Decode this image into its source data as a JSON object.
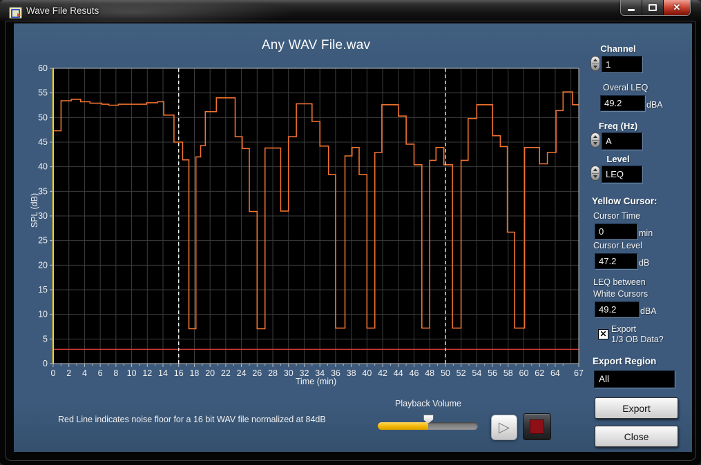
{
  "window": {
    "title": "Wave File Resuts"
  },
  "icons": {
    "close_glyph": "✕",
    "checkbox_mark": "✕",
    "play_glyph": "▷"
  },
  "chart_data": {
    "type": "line",
    "title": "Any WAV File.wav",
    "xlabel": "Time (min)",
    "ylabel": "SPL (dB)",
    "xlim": [
      0,
      67
    ],
    "ylim": [
      0,
      60
    ],
    "grid": true,
    "grid_step_x": 2,
    "grid_step_y": 5,
    "xticks": [
      0,
      2,
      4,
      6,
      8,
      10,
      12,
      14,
      16,
      18,
      20,
      22,
      24,
      26,
      28,
      30,
      32,
      34,
      36,
      38,
      40,
      42,
      44,
      46,
      48,
      50,
      52,
      54,
      56,
      58,
      60,
      62,
      64,
      67
    ],
    "yticks": [
      0,
      5,
      10,
      15,
      20,
      25,
      30,
      35,
      40,
      45,
      50,
      55,
      60
    ],
    "noise_floor_db": 2.9,
    "cursors": {
      "yellow": {
        "time_min": 0
      },
      "white": [
        {
          "time_min": 16
        },
        {
          "time_min": 50
        }
      ]
    },
    "series": [
      {
        "name": "SPL trace",
        "color": "#ef7230",
        "mode": "step",
        "end_time": 67,
        "steps": [
          [
            0,
            47.3
          ],
          [
            1,
            53.4
          ],
          [
            2.3,
            53.7
          ],
          [
            3.5,
            53.2
          ],
          [
            4.7,
            52.9
          ],
          [
            6.2,
            52.7
          ],
          [
            7.1,
            52.5
          ],
          [
            8.3,
            52.7
          ],
          [
            11.9,
            53.0
          ],
          [
            13.3,
            53.2
          ],
          [
            14.1,
            50.5
          ],
          [
            15.4,
            45.0
          ],
          [
            16.5,
            41.4
          ],
          [
            17.3,
            7.1
          ],
          [
            18.2,
            42.0
          ],
          [
            18.8,
            44.3
          ],
          [
            19.4,
            51.2
          ],
          [
            20.8,
            54.0
          ],
          [
            23.2,
            46.1
          ],
          [
            24.1,
            43.7
          ],
          [
            25.0,
            30.9
          ],
          [
            26.0,
            7.1
          ],
          [
            27.0,
            43.8
          ],
          [
            29.0,
            31.0
          ],
          [
            30.0,
            46.1
          ],
          [
            31.0,
            52.8
          ],
          [
            33.0,
            49.2
          ],
          [
            34.0,
            44.2
          ],
          [
            35.1,
            38.4
          ],
          [
            36.0,
            7.2
          ],
          [
            37.2,
            42.2
          ],
          [
            38.1,
            43.9
          ],
          [
            39.0,
            38.4
          ],
          [
            40.0,
            7.2
          ],
          [
            41.0,
            42.9
          ],
          [
            41.9,
            52.6
          ],
          [
            44.0,
            50.3
          ],
          [
            45.0,
            44.6
          ],
          [
            46.0,
            40.4
          ],
          [
            47.0,
            7.2
          ],
          [
            48.0,
            41.3
          ],
          [
            48.8,
            43.9
          ],
          [
            49.8,
            40.4
          ],
          [
            50.9,
            7.2
          ],
          [
            52.0,
            41.3
          ],
          [
            52.9,
            49.8
          ],
          [
            54.0,
            52.6
          ],
          [
            56.0,
            46.3
          ],
          [
            57.0,
            44.1
          ],
          [
            57.9,
            26.7
          ],
          [
            58.8,
            7.2
          ],
          [
            60.1,
            43.9
          ],
          [
            62.0,
            40.6
          ],
          [
            63.0,
            42.9
          ],
          [
            64.1,
            51.4
          ],
          [
            65.0,
            55.2
          ],
          [
            66.2,
            52.6
          ]
        ]
      }
    ],
    "colors": {
      "plot_bg": "#000000",
      "grid": "#3d3d3d",
      "frame": "#bcbcbc",
      "tick_text": "#f0f0f0",
      "noise_floor": "#d23b32",
      "cursor_yellow": "#ffd800",
      "cursor_white": "#ffffff"
    }
  },
  "note": "Red Line indicates noise floor for a 16 bit WAV file normalized at 84dB",
  "right_panel": {
    "channel": {
      "label": "Channel",
      "value": "1"
    },
    "overall_leq": {
      "label": "Overal LEQ",
      "value": "49.2",
      "unit": "dBA"
    },
    "freq": {
      "label": "Freq (Hz)",
      "value": "A"
    },
    "level": {
      "label": "Level",
      "value": "LEQ"
    },
    "yellow_cursor_heading": "Yellow Cursor:",
    "cursor_time": {
      "label": "Cursor Time",
      "value": "0",
      "unit": "min"
    },
    "cursor_level": {
      "label": "Cursor Level",
      "value": "47.2",
      "unit": "dB"
    },
    "leq_between": {
      "label_line1": "LEQ between",
      "label_line2": "White Cursors",
      "value": "49.2",
      "unit": "dBA"
    },
    "export_checkbox": {
      "checked": true,
      "label_line1": "Export",
      "label_line2": "1/3 OB Data?"
    },
    "export_region": {
      "label": "Export Region",
      "value": "All"
    },
    "export_button": "Export",
    "close_button": "Close"
  },
  "playback": {
    "label": "Playback Volume",
    "volume_percent": 50
  }
}
